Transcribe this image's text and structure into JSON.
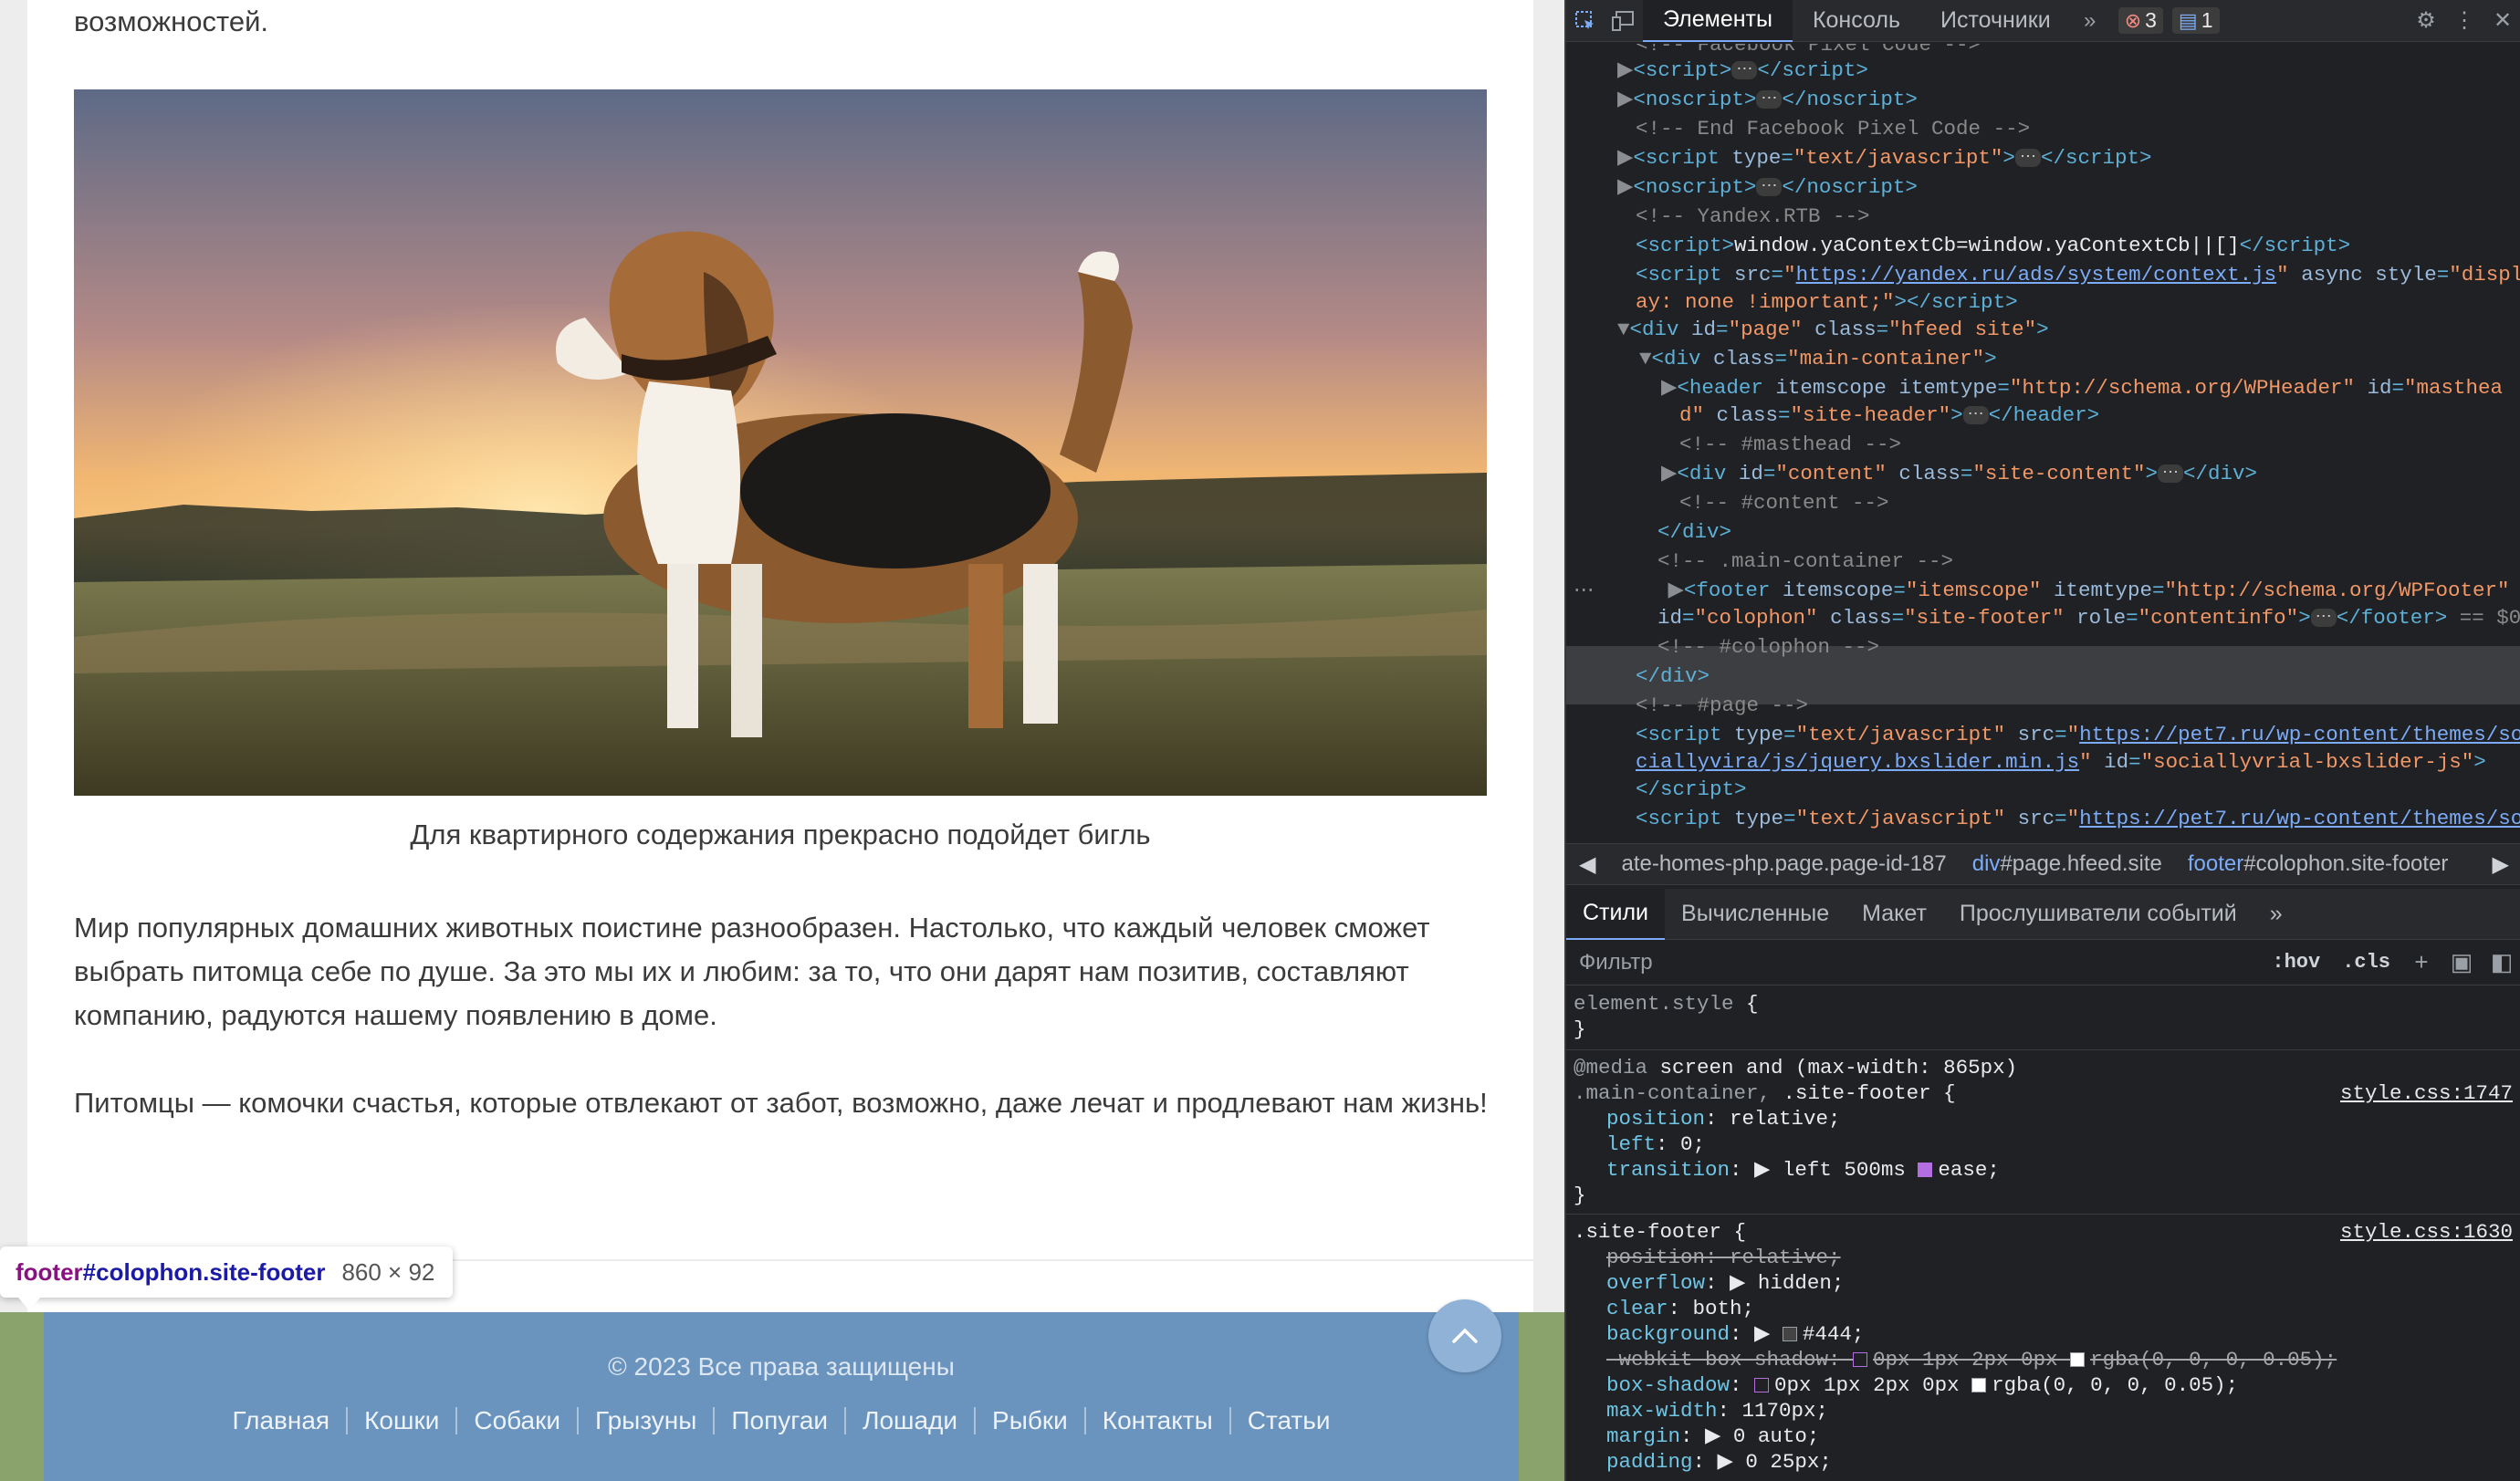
{
  "article": {
    "para_top": "возможностей.",
    "caption": "Для квартирного содержания прекрасно подойдет бигль",
    "para1": "Мир популярных домашних животных поистине разнообразен. Настолько, что каждый человек сможет выбрать питомца себе по душе. За это мы их и любим: за то, что они дарят нам позитив, составляют компанию, радуются нашему появлению в доме.",
    "para2": "Питомцы — комочки счастья, которые отвлекают от забот, возможно, даже лечат и продлевают нам жизнь!"
  },
  "inspect_tooltip": {
    "tag": "footer",
    "selector": "#colophon.site-footer",
    "size": "860 × 92"
  },
  "footer": {
    "copyright": "© 2023 Все права защищены",
    "nav": [
      "Главная",
      "Кошки",
      "Собаки",
      "Грызуны",
      "Попугаи",
      "Лошади",
      "Рыбки",
      "Контакты",
      "Статьи"
    ]
  },
  "devtools": {
    "tabs": [
      "Элементы",
      "Консоль",
      "Источники"
    ],
    "more_tabs": "»",
    "error_count": "3",
    "message_count": "1",
    "breadcrumbs": [
      {
        "text": "ate-homes-php.page.page-id-187",
        "tag": ""
      },
      {
        "text": "#page.hfeed.site",
        "tag": "div"
      },
      {
        "text": "#colophon.site-footer",
        "tag": "footer"
      }
    ],
    "style_tabs": [
      "Стили",
      "Вычисленные",
      "Макет",
      "Прослушиватели событий"
    ],
    "filter_placeholder": "Фильтр",
    "filter_buttons": [
      ":hov",
      ".cls"
    ],
    "selected_marker": "== $0"
  },
  "colors": {
    "footer_bg": "#6a93bd",
    "footer_margin": "#8aa36c",
    "scroll_button": "#8fb2d6",
    "devtools_bg": "#202124",
    "dom_tag": "#5db0d7",
    "dom_attr_value": "#f29766"
  }
}
